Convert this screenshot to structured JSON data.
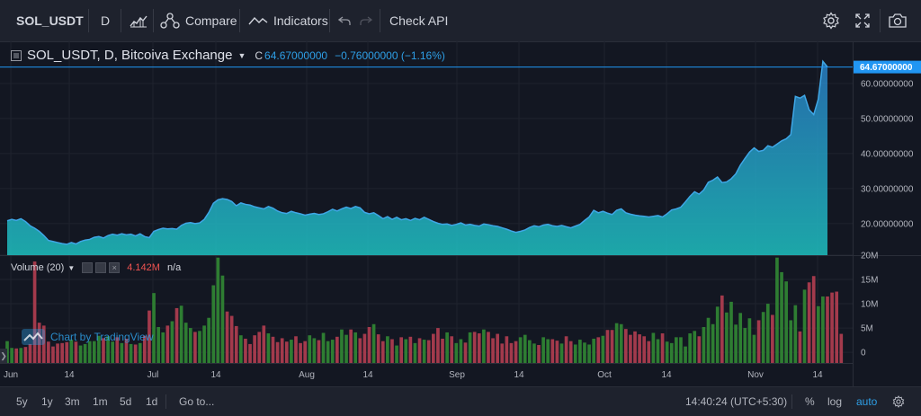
{
  "toolbar": {
    "symbol": "SOL_USDT",
    "interval": "D",
    "compare_label": "Compare",
    "indicators_label": "Indicators",
    "check_api_label": "Check API",
    "icons": [
      "candles-icon",
      "compare-icon",
      "indicators-icon",
      "undo-icon",
      "redo-icon",
      "gear-icon",
      "fullscreen-icon",
      "camera-icon"
    ]
  },
  "legend": {
    "title": "SOL_USDT, D, Bitcoiva Exchange",
    "c_label": "C",
    "c_value": "64.67000000",
    "change": "−0.76000000 (−1.16%)"
  },
  "volume_legend": {
    "title": "Volume (20)",
    "value": "4.142M",
    "ma_value": "n/a"
  },
  "watermark": "Chart by TradingView",
  "price_tag": "64.67000000",
  "bottom": {
    "ranges": [
      "5y",
      "1y",
      "3m",
      "1m",
      "5d",
      "1d"
    ],
    "goto": "Go to...",
    "time": "14:40:24 (UTC+5:30)",
    "percent": "%",
    "log": "log",
    "auto": "auto"
  },
  "colors": {
    "area_line": "#3fa7e6",
    "area_top": "#2b8bd9",
    "area_bottom": "#1ec0c0",
    "vol_up": "#2e7d32",
    "vol_down": "#a33a4c",
    "background": "#131722"
  },
  "chart_data": [
    {
      "type": "area",
      "title": "SOL_USDT, D, Bitcoiva Exchange",
      "x_ticks": [
        "Jun",
        "14",
        "Jul",
        "14",
        "Aug",
        "14",
        "Sep",
        "14",
        "Oct",
        "14",
        "Nov",
        "14"
      ],
      "y_ticks": [
        "20.00000000",
        "30.00000000",
        "40.00000000",
        "50.00000000",
        "60.00000000"
      ],
      "ylim": [
        11,
        72
      ],
      "grid": true,
      "series": [
        {
          "values": [
            20.8,
            21.2,
            20.9,
            21.4,
            20.6,
            19.4,
            18.7,
            17.8,
            16.6,
            15.2,
            14.9,
            14.6,
            14.3,
            14.1,
            14.6,
            14.2,
            14.9,
            15.3,
            15.5,
            16.1,
            16.3,
            15.9,
            16.6,
            17.0,
            16.7,
            17.1,
            16.8,
            17.0,
            16.5,
            17.1,
            16.3,
            16.0,
            17.8,
            18.3,
            18.7,
            18.5,
            18.6,
            18.4,
            19.5,
            20.1,
            20.3,
            20.0,
            20.2,
            21.2,
            23.2,
            25.8,
            26.8,
            27.1,
            26.9,
            26.3,
            25.1,
            25.9,
            25.5,
            25.3,
            24.8,
            24.5,
            24.2,
            24.9,
            24.4,
            23.6,
            23.1,
            22.9,
            23.5,
            23.1,
            22.8,
            22.4,
            22.7,
            22.9,
            22.6,
            22.8,
            23.4,
            24.1,
            23.6,
            24.2,
            24.7,
            24.3,
            24.9,
            24.5,
            23.2,
            22.8,
            23.1,
            22.3,
            21.4,
            22.0,
            21.2,
            21.8,
            21.1,
            21.4,
            20.9,
            21.5,
            21.1,
            21.8,
            21.2,
            20.6,
            20.1,
            19.8,
            19.9,
            19.5,
            19.8,
            20.2,
            19.6,
            19.8,
            19.5,
            19.3,
            19.9,
            19.7,
            19.4,
            19.2,
            18.8,
            18.4,
            17.9,
            17.5,
            17.8,
            18.2,
            18.9,
            19.4,
            19.1,
            19.6,
            19.8,
            19.4,
            19.2,
            19.5,
            19.1,
            18.8,
            19.3,
            19.8,
            20.9,
            21.9,
            23.8,
            23.1,
            23.5,
            23.0,
            22.6,
            23.8,
            24.2,
            23.1,
            22.7,
            22.4,
            22.2,
            22.1,
            21.9,
            22.1,
            22.3,
            21.9,
            22.8,
            23.9,
            24.2,
            24.7,
            26.2,
            27.8,
            29.1,
            28.4,
            29.6,
            31.8,
            32.4,
            33.3,
            31.7,
            31.9,
            32.8,
            34.2,
            36.7,
            38.6,
            40.4,
            41.6,
            40.6,
            40.9,
            42.2,
            41.8,
            42.7,
            43.6,
            44.2,
            45.4,
            56.3,
            55.8,
            56.6,
            52.5,
            51.1,
            55.5,
            66.3,
            64.67
          ]
        }
      ]
    },
    {
      "type": "bar",
      "title": "Volume (20)",
      "y_ticks": [
        "0",
        "5M",
        "10M",
        "15M",
        "20M"
      ],
      "ylim": [
        -2.2,
        20
      ],
      "units": "M",
      "series": [
        {
          "values": [
            2.3,
            0.9,
            0.8,
            0.9,
            1.1,
            1.7,
            18.7,
            6.1,
            5.5,
            2.2,
            1.2,
            1.8,
            1.9,
            2.1,
            2.6,
            2.2,
            1.4,
            1.7,
            2.3,
            2.3,
            3.4,
            2.9,
            3.3,
            2.2,
            3.1,
            1.9,
            2.8,
            1.7,
            1.6,
            1.9,
            3.4,
            8.6,
            12.2,
            5.2,
            4.1,
            5.5,
            6.4,
            9.1,
            9.6,
            6.1,
            5.0,
            4.2,
            4.4,
            5.5,
            7.1,
            13.8,
            19.5,
            15.8,
            8.4,
            7.5,
            5.4,
            3.5,
            2.8,
            1.7,
            3.5,
            4.2,
            5.5,
            3.9,
            3.2,
            2.1,
            2.9,
            2.2,
            2.6,
            3.3,
            1.9,
            2.3,
            3.5,
            2.9,
            2.5,
            4.0,
            2.3,
            2.6,
            3.2,
            4.7,
            3.6,
            4.7,
            4.1,
            2.9,
            3.8,
            5.2,
            5.8,
            3.7,
            2.3,
            3.3,
            2.7,
            1.4,
            3.1,
            2.7,
            3.2,
            1.9,
            2.9,
            2.6,
            2.5,
            3.8,
            5.0,
            2.8,
            4.1,
            3.3,
            1.9,
            2.7,
            2.0,
            4.1,
            4.2,
            3.9,
            4.7,
            4.2,
            2.9,
            3.8,
            1.8,
            3.3,
            1.9,
            2.3,
            3.1,
            3.6,
            2.5,
            1.8,
            1.5,
            3.1,
            2.7,
            2.7,
            2.4,
            1.8,
            3.3,
            2.3,
            1.6,
            2.6,
            2.0,
            1.6,
            2.8,
            3.1,
            3.4,
            4.6,
            4.6,
            6.0,
            5.8,
            4.8,
            3.6,
            4.3,
            3.7,
            3.3,
            2.3,
            4.0,
            2.7,
            3.9,
            2.2,
            1.9,
            3.1,
            3.1,
            1.2,
            3.9,
            4.4,
            3.3,
            5.2,
            7.1,
            5.8,
            9.4,
            11.7,
            8.2,
            10.4,
            5.7,
            8.1,
            5.0,
            7.0,
            3.6,
            6.6,
            8.3,
            10.0,
            7.7,
            19.5,
            16.5,
            14.6,
            6.6,
            9.7,
            4.3,
            12.9,
            14.4,
            15.7,
            9.5,
            11.5,
            11.5,
            12.3,
            12.5,
            3.8
          ]
        }
      ]
    }
  ]
}
